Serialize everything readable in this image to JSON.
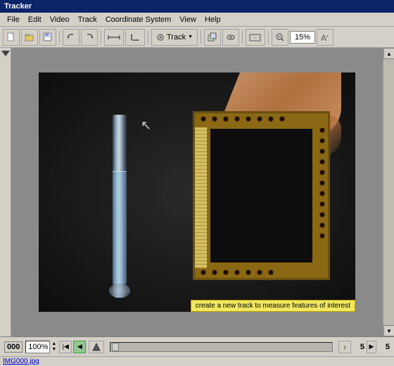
{
  "window": {
    "title": "Tracker"
  },
  "menubar": {
    "items": [
      "File",
      "Edit",
      "Video",
      "Track",
      "Coordinate System",
      "View",
      "Help"
    ]
  },
  "toolbar": {
    "track_label": "Track",
    "zoom_value": "15%",
    "buttons": [
      "new",
      "open",
      "save",
      "undo",
      "redo",
      "calibration",
      "axes",
      "track",
      "clone",
      "visibility",
      "coords",
      "zoom_out",
      "zoom_in"
    ]
  },
  "video": {
    "status_text": "create a new track to measure features of interest"
  },
  "playback": {
    "frame_number": "000",
    "percentage": "100%",
    "frame_count_left": "5",
    "frame_count_right": "5"
  },
  "statusbar": {
    "filename": "IMG000.jpg"
  },
  "icons": {
    "play": "▶",
    "rewind": "◀",
    "step_back": "◀",
    "step_fwd": "▶",
    "loop": "↺",
    "speaker": "♪",
    "scroll_up": "▲",
    "scroll_down": "▼",
    "arrow_cursor": "↖"
  }
}
